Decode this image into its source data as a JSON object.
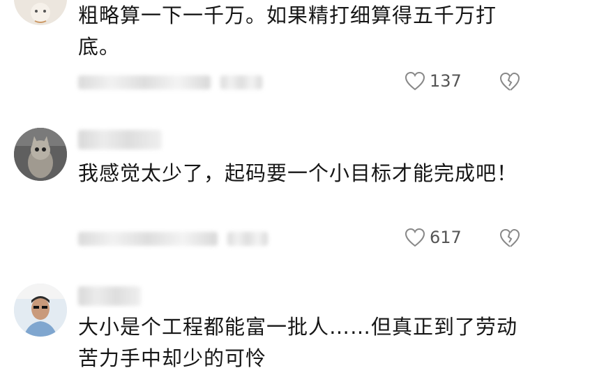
{
  "comments": [
    {
      "text": "粗略算一下一千万。如果精打细算得五千万打底。",
      "likes": "137",
      "avatar_icon": "avatar-cartoon-icon"
    },
    {
      "text": "我感觉太少了，起码要一个小目标才能完成吧！",
      "likes": "617",
      "avatar_icon": "avatar-cat-icon"
    },
    {
      "text": "大小是个工程都能富一批人……但真正到了劳动苦力手中却少的可怜",
      "avatar_icon": "avatar-person-icon"
    }
  ]
}
